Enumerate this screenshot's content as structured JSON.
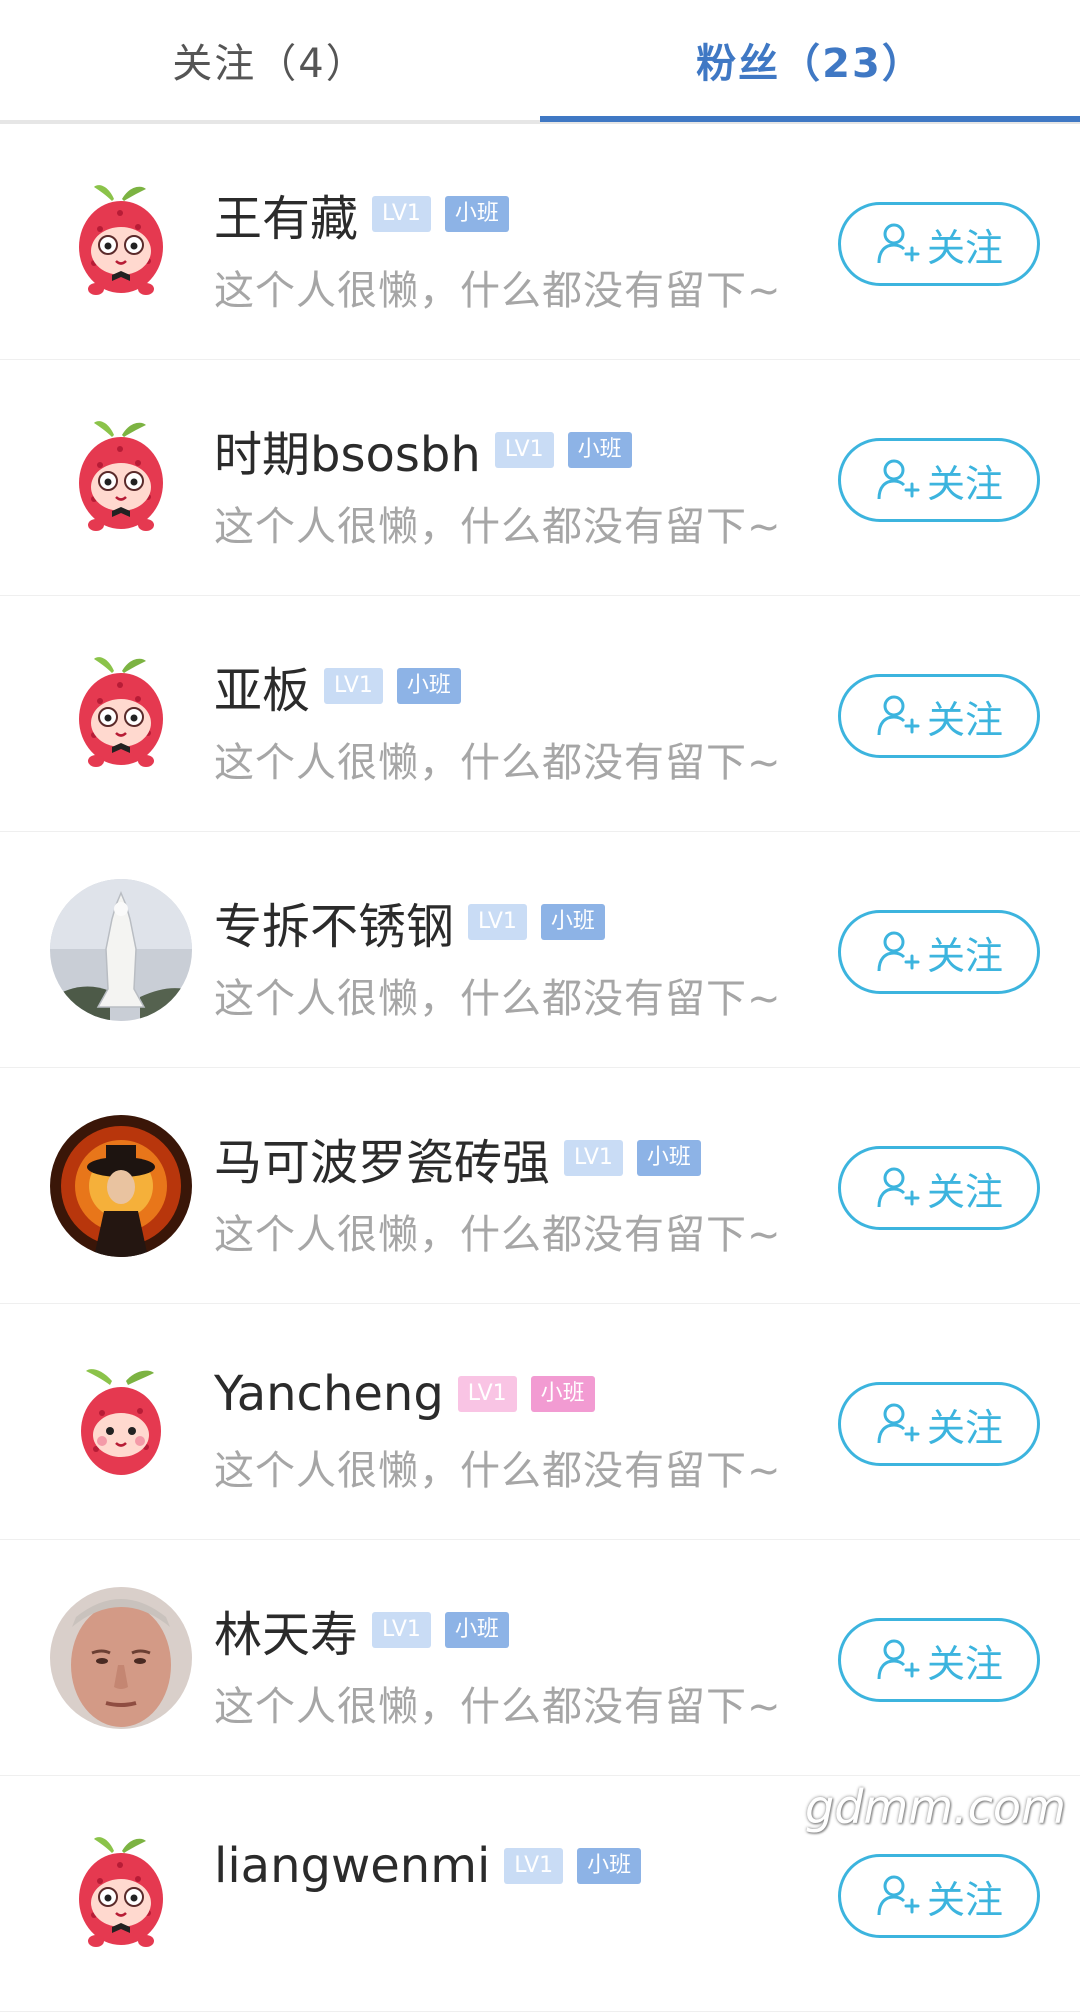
{
  "tabs": [
    {
      "label": "关注（4）"
    },
    {
      "label": "粉丝（23）"
    }
  ],
  "rows": [
    {
      "name": "王有藏",
      "level": "LV1",
      "class": "小班",
      "bio": "这个人很懒，什么都没有留下~",
      "follow": "关注"
    },
    {
      "name": "时期bsosbh",
      "level": "LV1",
      "class": "小班",
      "bio": "这个人很懒，什么都没有留下~",
      "follow": "关注"
    },
    {
      "name": "亚板",
      "level": "LV1",
      "class": "小班",
      "bio": "这个人很懒，什么都没有留下~",
      "follow": "关注"
    },
    {
      "name": "专拆不锈钢",
      "level": "LV1",
      "class": "小班",
      "bio": "这个人很懒，什么都没有留下~",
      "follow": "关注"
    },
    {
      "name": "马可波罗瓷砖强",
      "level": "LV1",
      "class": "小班",
      "bio": "这个人很懒，什么都没有留下~",
      "follow": "关注"
    },
    {
      "name": "Yancheng",
      "level": "LV1",
      "class": "小班",
      "bio": "这个人很懒，什么都没有留下~",
      "follow": "关注"
    },
    {
      "name": "林天寿",
      "level": "LV1",
      "class": "小班",
      "bio": "这个人很懒，什么都没有留下~",
      "follow": "关注"
    },
    {
      "name": "liangwenmi",
      "level": "LV1",
      "class": "小班",
      "bio": "",
      "follow": "关注"
    }
  ],
  "watermark": "gdmm.com",
  "colors": {
    "accent": "#3f78c4",
    "follow": "#3cb4de",
    "bio": "#a6a6a6"
  }
}
